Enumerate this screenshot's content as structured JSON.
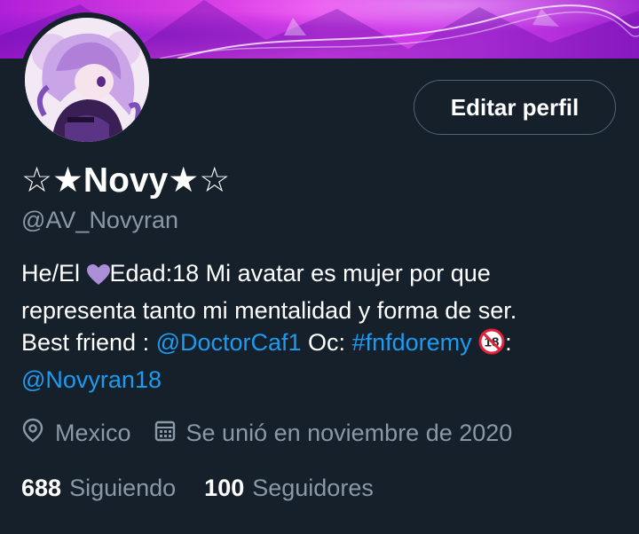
{
  "header": {
    "banner_colors": [
      "#b020d8",
      "#e94af0",
      "#a020d0"
    ]
  },
  "profile": {
    "edit_button_label": "Editar perfil",
    "display_name": "☆★Novy★☆",
    "handle": "@AV_Novyran",
    "bio": {
      "line1_a": "He/El ",
      "line1_emoji": "purple-heart",
      "line1_b": "Edad:18 Mi avatar es mujer por que",
      "line2": "representa tanto mi mentalidad y forma de ser.",
      "line3_a": "Best friend : ",
      "line3_mention": "@DoctorCaf1",
      "line3_b": " Oc: ",
      "line3_hashtag": "#fnfdoremy",
      "line3_emoji": "no-under-18",
      "line3_c": ":",
      "line4_mention": "@Novyran18"
    },
    "location": "Mexico",
    "joined": "Se unió en noviembre de 2020",
    "following_count": "688",
    "following_label": "Siguiendo",
    "followers_count": "100",
    "followers_label": "Seguidores"
  },
  "colors": {
    "background": "#15202b",
    "link": "#1d9bf0",
    "secondary_text": "#8b98a5"
  }
}
